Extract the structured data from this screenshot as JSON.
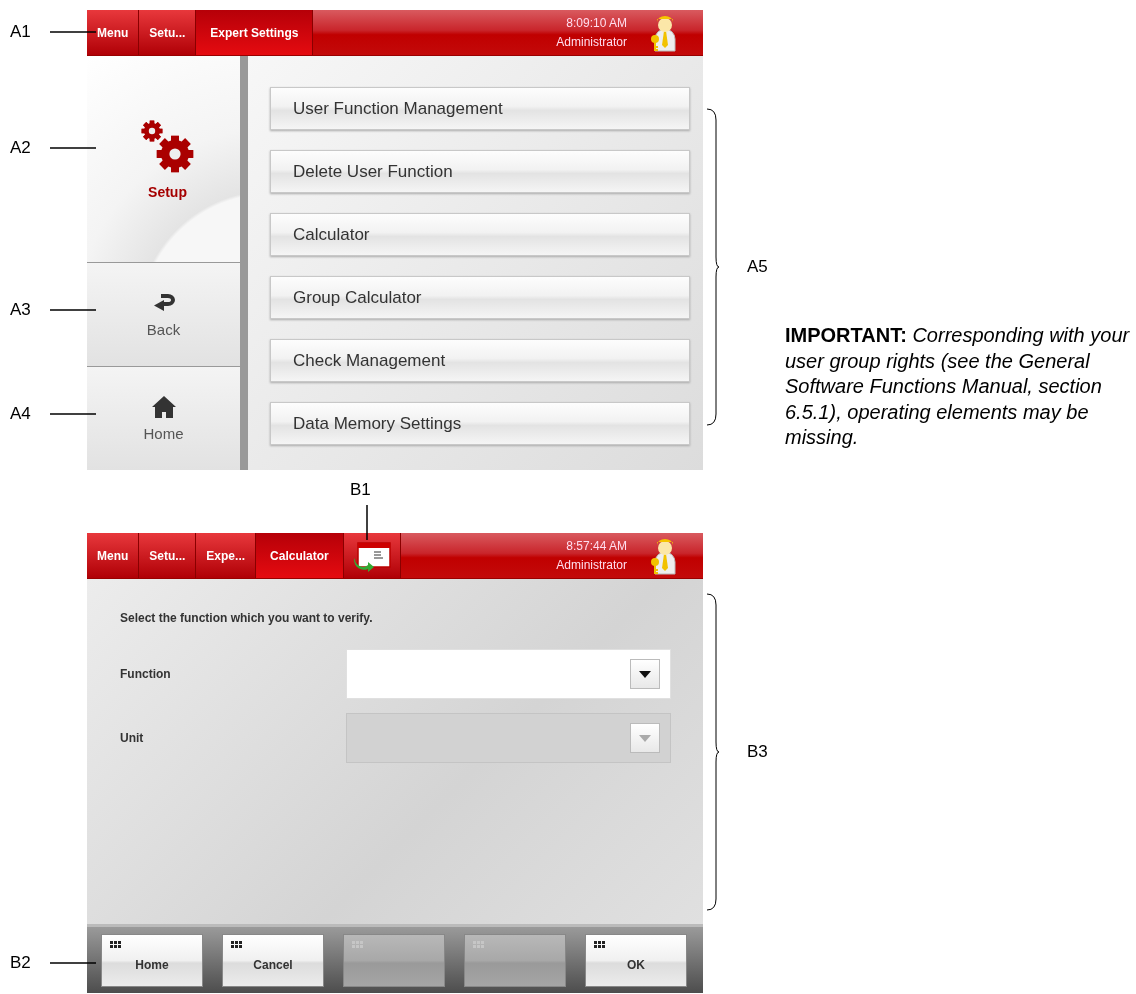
{
  "screen_a": {
    "header": {
      "tabs": [
        {
          "label": "Menu",
          "selected": false
        },
        {
          "label": "Setu...",
          "selected": false
        },
        {
          "label": "Expert Settings",
          "selected": true
        }
      ],
      "time": "8:09:10 AM",
      "user": "Administrator"
    },
    "sidebar": {
      "title": "Setup",
      "items": [
        {
          "label": "Back",
          "kind": "back"
        },
        {
          "label": "Home",
          "kind": "home"
        }
      ]
    },
    "buttons": [
      "User Function Management",
      "Delete User Function",
      "Calculator",
      "Group Calculator",
      "Check Management",
      "Data Memory Settings"
    ]
  },
  "note": "**IMPORTANT:** *Corresponding with your user group rights (see the General Software Functions Manual, section 6.5.1), operating elements may be missing.*",
  "screen_b": {
    "header": {
      "tabs": [
        {
          "label": "Menu",
          "selected": false
        },
        {
          "label": "Setu...",
          "selected": false
        },
        {
          "label": "Expe...",
          "selected": false
        },
        {
          "label": "Calculator",
          "selected": true
        }
      ],
      "time": "8:57:44 AM",
      "user": "Administrator"
    },
    "prompt": "Select the function which you want to verify.",
    "fields": [
      {
        "label": "Function",
        "disabled": false
      },
      {
        "label": "Unit",
        "disabled": true
      }
    ],
    "footer_buttons": [
      {
        "label": "Home",
        "disabled": false
      },
      {
        "label": "Cancel",
        "disabled": false
      },
      {
        "disabled": true
      },
      {
        "disabled": true
      },
      {
        "label": "OK",
        "disabled": false
      }
    ]
  },
  "callouts": [
    {
      "label": "A1",
      "kind": "line"
    },
    {
      "label": "A2",
      "kind": "line"
    },
    {
      "label": "A3",
      "kind": "line"
    },
    {
      "label": "A4",
      "kind": "line"
    },
    {
      "label": "A5",
      "kind": "brace"
    },
    {
      "label": "B1",
      "kind": "top"
    },
    {
      "label": "B2",
      "kind": "line"
    },
    {
      "label": "B3",
      "kind": "brace"
    }
  ]
}
